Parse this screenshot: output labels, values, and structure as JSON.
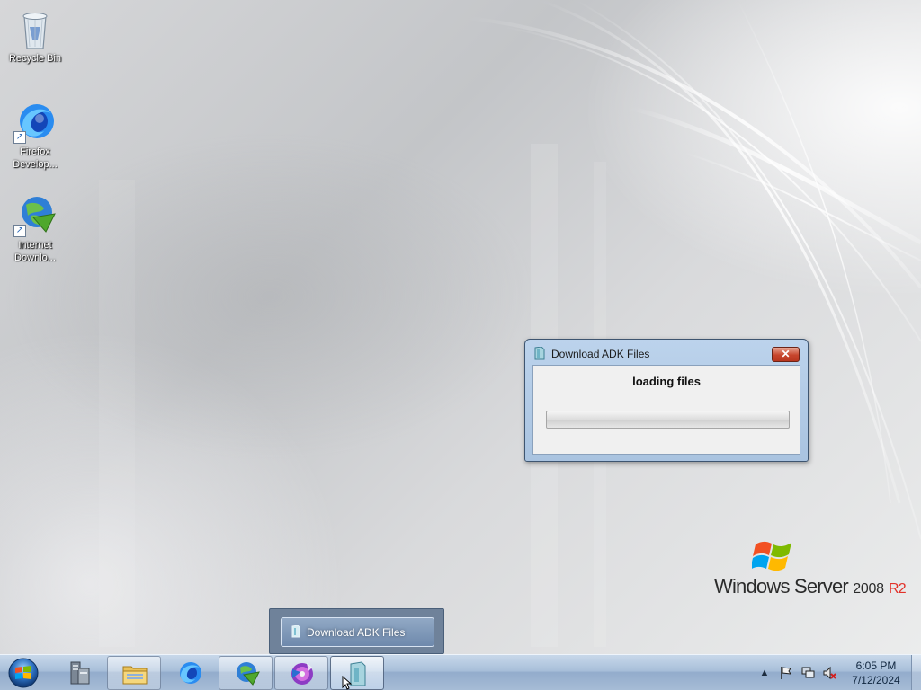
{
  "desktop": {
    "icons": [
      {
        "label": "Recycle Bin",
        "icon": "recycle-bin-icon"
      },
      {
        "label": "Firefox\nDevelop...",
        "icon": "firefox-developer-icon"
      },
      {
        "label": "Internet\nDownlo...",
        "icon": "internet-download-manager-icon"
      }
    ],
    "branding": {
      "windows": "Windows Server",
      "version": "2008",
      "edition": "R2"
    }
  },
  "dialog": {
    "title": "Download ADK Files",
    "close_label": "✕",
    "message": "loading files",
    "progress_fraction": 0
  },
  "taskbar_thumbnail": {
    "label": "Download ADK Files"
  },
  "taskbar": {
    "buttons": [
      {
        "name": "server-manager",
        "icon": "server-manager-icon"
      },
      {
        "name": "file-explorer",
        "icon": "folder-icon"
      },
      {
        "name": "firefox",
        "icon": "firefox-icon"
      },
      {
        "name": "internet-download-manager",
        "icon": "idm-icon"
      },
      {
        "name": "media-app",
        "icon": "media-disc-icon"
      },
      {
        "name": "download-adk-files",
        "icon": "app-window-icon"
      }
    ],
    "clock": {
      "time": "6:05 PM",
      "date": "7/12/2024"
    }
  },
  "colors": {
    "taskbar": "#a8bfd9",
    "dialog_frame": "#bcd3ec",
    "close_button": "#c7452c"
  }
}
